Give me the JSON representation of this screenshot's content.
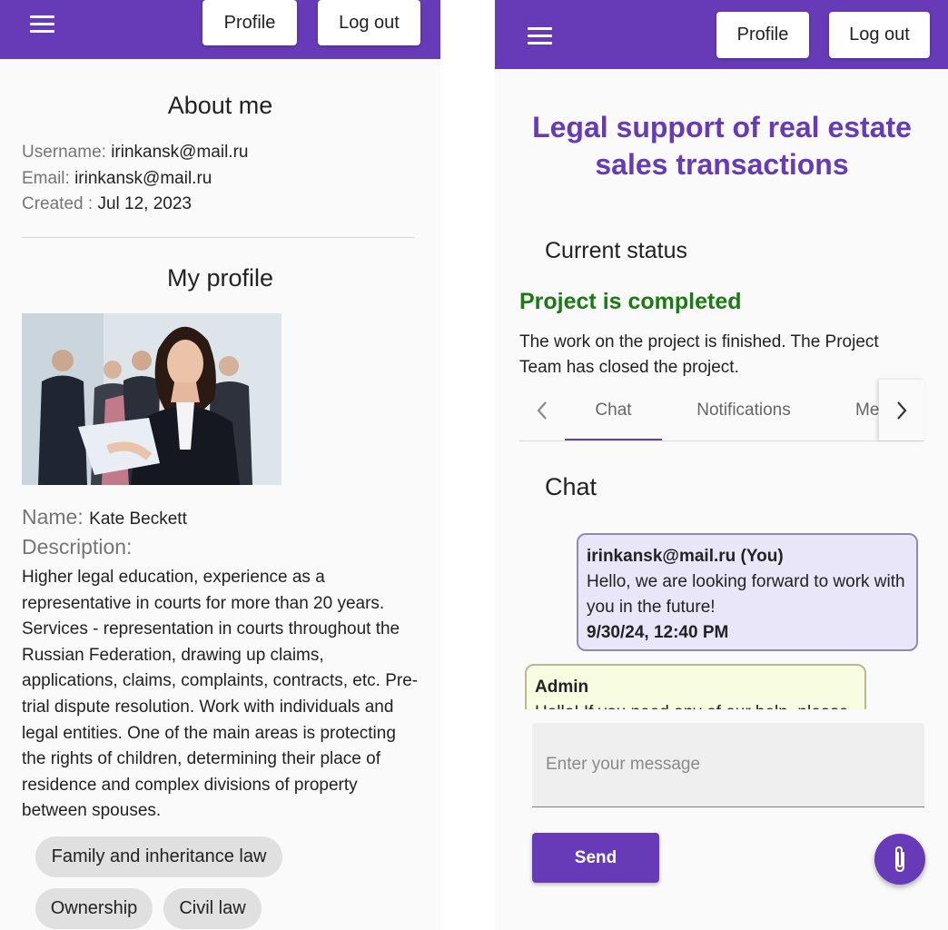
{
  "header": {
    "profile_label": "Profile",
    "logout_label": "Log out"
  },
  "about": {
    "title": "About me",
    "username_label": "Username:",
    "username_value": "irinkansk@mail.ru",
    "email_label": "Email:",
    "email_value": "irinkansk@mail.ru",
    "created_label": "Created :",
    "created_value": "Jul 12, 2023"
  },
  "profile": {
    "title": "My profile",
    "name_label": "Name:",
    "name_value": "Kate Beckett",
    "description_label": "Description:",
    "description": "Higher legal education, experience as a representative in courts for more than 20 years. Services - representation in courts throughout the Russian Federation, drawing up claims, applications, claims, complaints, contracts, etc. Pre-trial dispute resolution. Work with individuals and legal entities. One of the main areas is protecting the rights of children, determining their place of residence and complex divisions of property between spouses.",
    "chips": [
      "Family and inheritance law",
      "Ownership",
      "Civil law"
    ]
  },
  "project": {
    "title": "Legal support of real estate sales transactions",
    "status_heading": "Current status",
    "status_value": "Project is completed",
    "status_description": " The work on the project is finished. The Project Team has closed the project."
  },
  "tabs": {
    "items": [
      "Chat",
      "Notifications",
      "Me"
    ],
    "active": "Chat"
  },
  "chat": {
    "title": "Chat",
    "messages": [
      {
        "author": "irinkansk@mail.ru (You)",
        "text": "Hello, we are looking forward to work with you in the future!",
        "time": "9/30/24, 12:40 PM"
      },
      {
        "author": "Admin",
        "text": "Hello! If you need any of our help, please"
      }
    ],
    "input_placeholder": "Enter your message",
    "send_label": "Send"
  },
  "icons": {
    "menu": "menu-icon",
    "prev": "chevron-left-icon",
    "next": "chevron-right-icon",
    "attach": "paperclip-icon"
  },
  "colors": {
    "primary": "#673ab7",
    "status_completed": "#1b7a12",
    "own_message_bg": "#e8e6f8",
    "other_message_bg": "#f8fde2"
  }
}
